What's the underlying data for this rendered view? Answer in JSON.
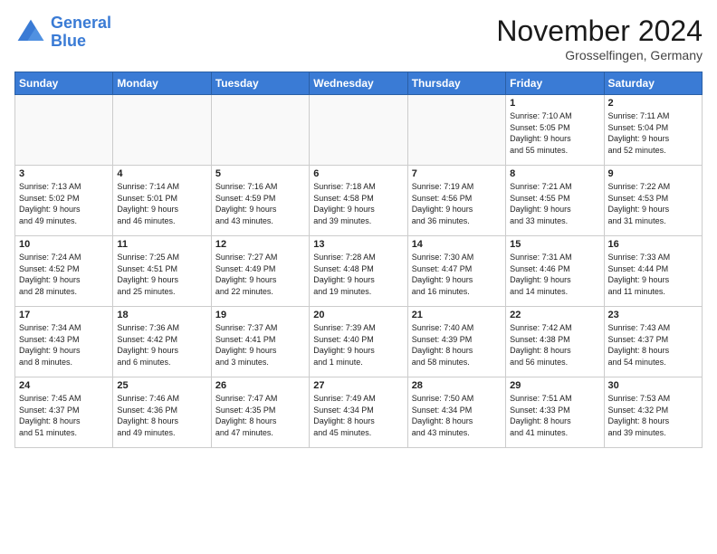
{
  "logo": {
    "line1": "General",
    "line2": "Blue"
  },
  "title": "November 2024",
  "location": "Grosselfingen, Germany",
  "headers": [
    "Sunday",
    "Monday",
    "Tuesday",
    "Wednesday",
    "Thursday",
    "Friday",
    "Saturday"
  ],
  "weeks": [
    [
      {
        "day": "",
        "info": ""
      },
      {
        "day": "",
        "info": ""
      },
      {
        "day": "",
        "info": ""
      },
      {
        "day": "",
        "info": ""
      },
      {
        "day": "",
        "info": ""
      },
      {
        "day": "1",
        "info": "Sunrise: 7:10 AM\nSunset: 5:05 PM\nDaylight: 9 hours\nand 55 minutes."
      },
      {
        "day": "2",
        "info": "Sunrise: 7:11 AM\nSunset: 5:04 PM\nDaylight: 9 hours\nand 52 minutes."
      }
    ],
    [
      {
        "day": "3",
        "info": "Sunrise: 7:13 AM\nSunset: 5:02 PM\nDaylight: 9 hours\nand 49 minutes."
      },
      {
        "day": "4",
        "info": "Sunrise: 7:14 AM\nSunset: 5:01 PM\nDaylight: 9 hours\nand 46 minutes."
      },
      {
        "day": "5",
        "info": "Sunrise: 7:16 AM\nSunset: 4:59 PM\nDaylight: 9 hours\nand 43 minutes."
      },
      {
        "day": "6",
        "info": "Sunrise: 7:18 AM\nSunset: 4:58 PM\nDaylight: 9 hours\nand 39 minutes."
      },
      {
        "day": "7",
        "info": "Sunrise: 7:19 AM\nSunset: 4:56 PM\nDaylight: 9 hours\nand 36 minutes."
      },
      {
        "day": "8",
        "info": "Sunrise: 7:21 AM\nSunset: 4:55 PM\nDaylight: 9 hours\nand 33 minutes."
      },
      {
        "day": "9",
        "info": "Sunrise: 7:22 AM\nSunset: 4:53 PM\nDaylight: 9 hours\nand 31 minutes."
      }
    ],
    [
      {
        "day": "10",
        "info": "Sunrise: 7:24 AM\nSunset: 4:52 PM\nDaylight: 9 hours\nand 28 minutes."
      },
      {
        "day": "11",
        "info": "Sunrise: 7:25 AM\nSunset: 4:51 PM\nDaylight: 9 hours\nand 25 minutes."
      },
      {
        "day": "12",
        "info": "Sunrise: 7:27 AM\nSunset: 4:49 PM\nDaylight: 9 hours\nand 22 minutes."
      },
      {
        "day": "13",
        "info": "Sunrise: 7:28 AM\nSunset: 4:48 PM\nDaylight: 9 hours\nand 19 minutes."
      },
      {
        "day": "14",
        "info": "Sunrise: 7:30 AM\nSunset: 4:47 PM\nDaylight: 9 hours\nand 16 minutes."
      },
      {
        "day": "15",
        "info": "Sunrise: 7:31 AM\nSunset: 4:46 PM\nDaylight: 9 hours\nand 14 minutes."
      },
      {
        "day": "16",
        "info": "Sunrise: 7:33 AM\nSunset: 4:44 PM\nDaylight: 9 hours\nand 11 minutes."
      }
    ],
    [
      {
        "day": "17",
        "info": "Sunrise: 7:34 AM\nSunset: 4:43 PM\nDaylight: 9 hours\nand 8 minutes."
      },
      {
        "day": "18",
        "info": "Sunrise: 7:36 AM\nSunset: 4:42 PM\nDaylight: 9 hours\nand 6 minutes."
      },
      {
        "day": "19",
        "info": "Sunrise: 7:37 AM\nSunset: 4:41 PM\nDaylight: 9 hours\nand 3 minutes."
      },
      {
        "day": "20",
        "info": "Sunrise: 7:39 AM\nSunset: 4:40 PM\nDaylight: 9 hours\nand 1 minute."
      },
      {
        "day": "21",
        "info": "Sunrise: 7:40 AM\nSunset: 4:39 PM\nDaylight: 8 hours\nand 58 minutes."
      },
      {
        "day": "22",
        "info": "Sunrise: 7:42 AM\nSunset: 4:38 PM\nDaylight: 8 hours\nand 56 minutes."
      },
      {
        "day": "23",
        "info": "Sunrise: 7:43 AM\nSunset: 4:37 PM\nDaylight: 8 hours\nand 54 minutes."
      }
    ],
    [
      {
        "day": "24",
        "info": "Sunrise: 7:45 AM\nSunset: 4:37 PM\nDaylight: 8 hours\nand 51 minutes."
      },
      {
        "day": "25",
        "info": "Sunrise: 7:46 AM\nSunset: 4:36 PM\nDaylight: 8 hours\nand 49 minutes."
      },
      {
        "day": "26",
        "info": "Sunrise: 7:47 AM\nSunset: 4:35 PM\nDaylight: 8 hours\nand 47 minutes."
      },
      {
        "day": "27",
        "info": "Sunrise: 7:49 AM\nSunset: 4:34 PM\nDaylight: 8 hours\nand 45 minutes."
      },
      {
        "day": "28",
        "info": "Sunrise: 7:50 AM\nSunset: 4:34 PM\nDaylight: 8 hours\nand 43 minutes."
      },
      {
        "day": "29",
        "info": "Sunrise: 7:51 AM\nSunset: 4:33 PM\nDaylight: 8 hours\nand 41 minutes."
      },
      {
        "day": "30",
        "info": "Sunrise: 7:53 AM\nSunset: 4:32 PM\nDaylight: 8 hours\nand 39 minutes."
      }
    ]
  ]
}
